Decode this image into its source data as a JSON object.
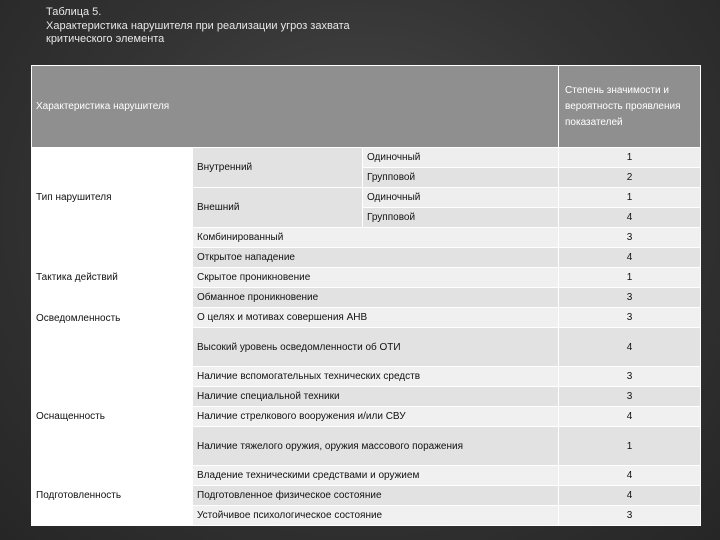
{
  "caption": {
    "line1": "Таблица 5.",
    "line2": "Характеристика нарушителя при реализации угроз захвата",
    "line3": "критического элемента"
  },
  "table": {
    "header": {
      "left": "Характеристика нарушителя",
      "right": "Степень значимости и вероятность проявления показателей"
    },
    "type_group": {
      "label": "Тип нарушителя",
      "internal": "Внутренний",
      "external": "Внешний",
      "rows": [
        {
          "mode": "Одиночный",
          "value": "1"
        },
        {
          "mode": "Групповой",
          "value": "2"
        },
        {
          "mode": "Одиночный",
          "value": "1"
        },
        {
          "mode": "Групповой",
          "value": "4"
        }
      ],
      "combined": {
        "label": "Комбинированный",
        "value": "3"
      }
    },
    "tactics": {
      "label": "Тактика действий",
      "rows": [
        {
          "text": "Открытое нападение",
          "value": "4"
        },
        {
          "text": "Скрытое проникновение",
          "value": "1"
        },
        {
          "text": "Обманное проникновение",
          "value": "3"
        }
      ]
    },
    "awareness": {
      "label": "Осведомленность",
      "rows": [
        {
          "text": "О целях и мотивах совершения АНВ",
          "value": "3"
        },
        {
          "text": "Высокий уровень осведомленности об ОТИ",
          "value": "4"
        }
      ]
    },
    "equipment": {
      "label": "Оснащенность",
      "rows": [
        {
          "text": "Наличие вспомогательных технических средств",
          "value": "3"
        },
        {
          "text": "Наличие специальной техники",
          "value": "3"
        },
        {
          "text": "Наличие стрелкового вооружения и/или СВУ",
          "value": "4"
        },
        {
          "text": "Наличие тяжелого оружия, оружия массового поражения",
          "value": "1"
        }
      ]
    },
    "preparedness": {
      "label": "Подготовленность",
      "rows": [
        {
          "text": "Владение техническими средствами и оружием",
          "value": "4"
        },
        {
          "text": "Подготовленное физическое состояние",
          "value": "4"
        },
        {
          "text": "Устойчивое психологическое состояние",
          "value": "3"
        }
      ]
    }
  }
}
